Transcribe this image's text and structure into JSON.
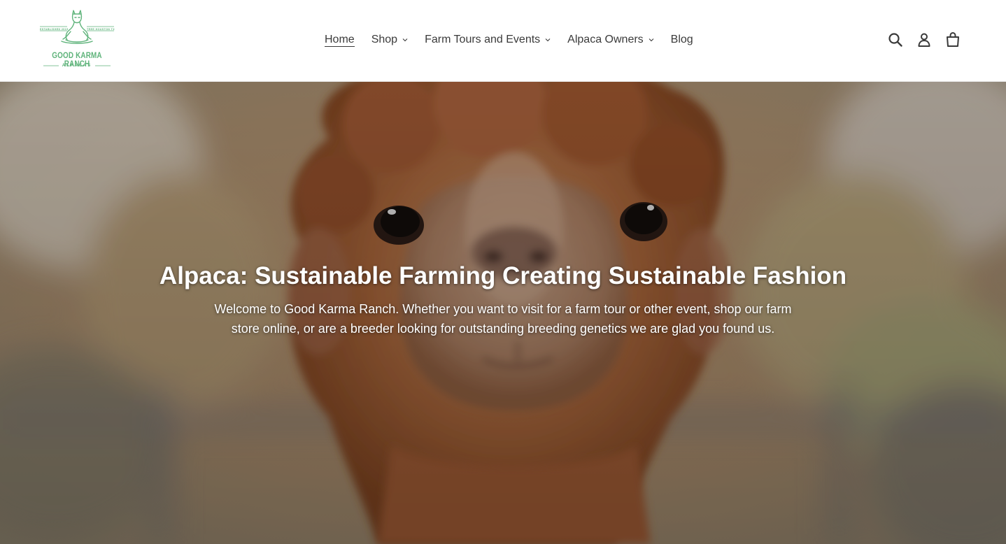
{
  "brand": {
    "name": "GOOD KARMA RANCH",
    "sub": "ALPACAS",
    "est_left": "ESTABLISHED 2015",
    "est_right": "TREE HOUSTON TX",
    "logo_color": "#5eb37a"
  },
  "nav": {
    "items": [
      {
        "label": "Home",
        "active": true,
        "dropdown": false
      },
      {
        "label": "Shop",
        "active": false,
        "dropdown": true
      },
      {
        "label": "Farm Tours and Events",
        "active": false,
        "dropdown": true
      },
      {
        "label": "Alpaca Owners",
        "active": false,
        "dropdown": true
      },
      {
        "label": "Blog",
        "active": false,
        "dropdown": false
      }
    ]
  },
  "header_icons": [
    "search-icon",
    "account-icon",
    "cart-icon"
  ],
  "hero": {
    "title": "Alpaca: Sustainable Farming Creating Sustainable Fashion",
    "text": "Welcome to Good Karma Ranch. Whether you want to visit for a farm tour or other event, shop our farm store online, or are a breeder looking for outstanding breeding genetics we are glad you found us.",
    "image": "brown alpaca face close-up"
  }
}
